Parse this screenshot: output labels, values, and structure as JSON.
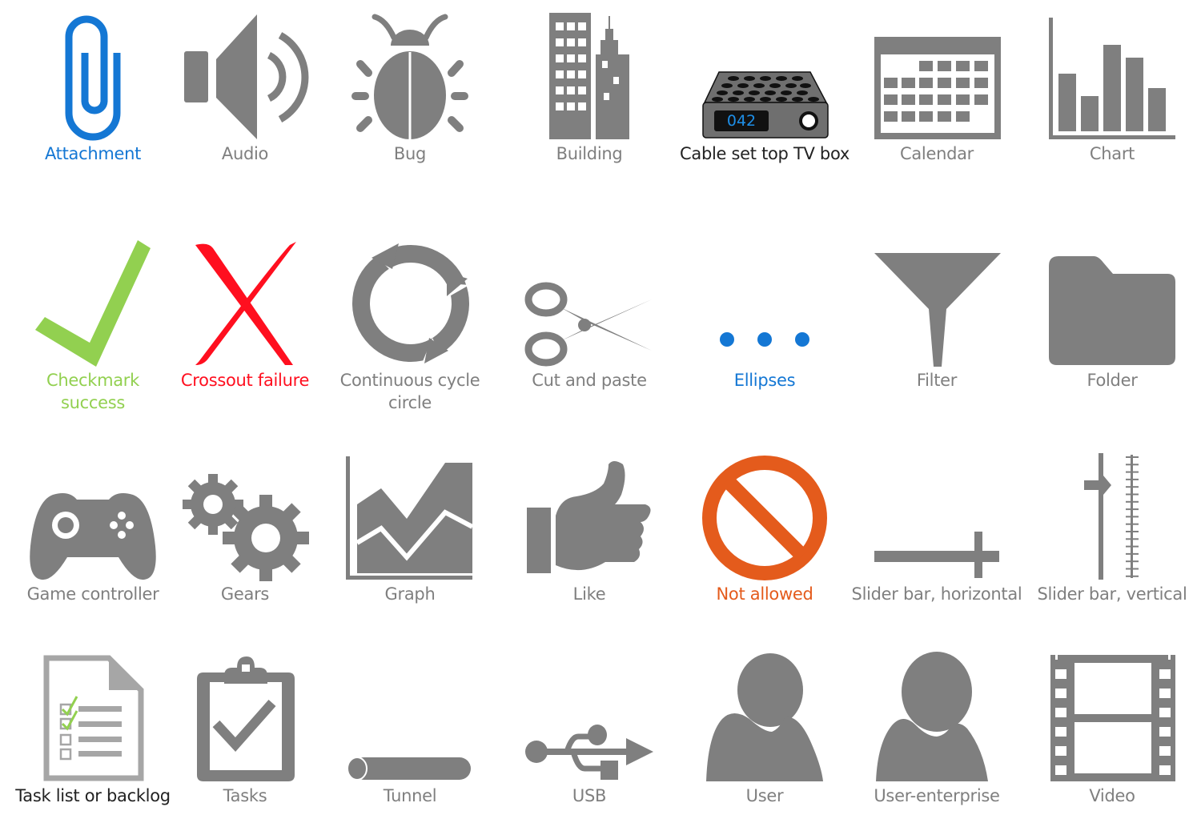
{
  "colors": {
    "gray": "#7f7f7f",
    "blue": "#1477d4",
    "green": "#92d050",
    "red": "#ff0f1f",
    "orange": "#e45b1c",
    "dark": "#222222",
    "light_gray": "#a6a6a6"
  },
  "icons": [
    {
      "id": "attachment",
      "label": "Attachment",
      "icon": "paperclip-icon",
      "color": "#1477d4"
    },
    {
      "id": "audio",
      "label": "Audio",
      "icon": "speaker-icon",
      "color": "#7f7f7f"
    },
    {
      "id": "bug",
      "label": "Bug",
      "icon": "bug-icon",
      "color": "#7f7f7f"
    },
    {
      "id": "building",
      "label": "Building",
      "icon": "building-icon",
      "color": "#7f7f7f"
    },
    {
      "id": "cable-box",
      "label": "Cable set top TV box",
      "icon": "cable-box-icon",
      "color": "#222222",
      "display_value": "042"
    },
    {
      "id": "calendar",
      "label": "Calendar",
      "icon": "calendar-icon",
      "color": "#7f7f7f"
    },
    {
      "id": "chart",
      "label": "Chart",
      "icon": "bar-chart-icon",
      "color": "#7f7f7f"
    },
    {
      "id": "checkmark",
      "label": "Checkmark\nsuccess",
      "label_line1": "Checkmark",
      "label_line2": "success",
      "icon": "checkmark-icon",
      "color": "#92d050"
    },
    {
      "id": "crossout",
      "label": "Crossout failure",
      "icon": "cross-icon",
      "color": "#ff0f1f"
    },
    {
      "id": "cycle",
      "label": "Continuous cycle circle",
      "label_line1": "Continuous cycle",
      "label_line2": "circle",
      "icon": "cycle-icon",
      "color": "#7f7f7f"
    },
    {
      "id": "cut",
      "label": "Cut and paste",
      "icon": "scissors-icon",
      "color": "#7f7f7f"
    },
    {
      "id": "ellipses",
      "label": "Ellipses",
      "icon": "ellipsis-icon",
      "color": "#1477d4"
    },
    {
      "id": "filter",
      "label": "Filter",
      "icon": "funnel-icon",
      "color": "#7f7f7f"
    },
    {
      "id": "folder",
      "label": "Folder",
      "icon": "folder-icon",
      "color": "#7f7f7f"
    },
    {
      "id": "game",
      "label": "Game controller",
      "icon": "gamepad-icon",
      "color": "#7f7f7f"
    },
    {
      "id": "gears",
      "label": "Gears",
      "icon": "gears-icon",
      "color": "#7f7f7f"
    },
    {
      "id": "graph",
      "label": "Graph",
      "icon": "area-graph-icon",
      "color": "#7f7f7f"
    },
    {
      "id": "like",
      "label": "Like",
      "icon": "thumbs-up-icon",
      "color": "#7f7f7f"
    },
    {
      "id": "not-allowed",
      "label": "Not allowed",
      "icon": "prohibited-icon",
      "color": "#e45b1c"
    },
    {
      "id": "slider-h",
      "label": "Slider bar, horizontal",
      "icon": "slider-horizontal-icon",
      "color": "#7f7f7f"
    },
    {
      "id": "slider-v",
      "label": "Slider bar, vertical",
      "icon": "slider-vertical-icon",
      "color": "#7f7f7f"
    },
    {
      "id": "task-list",
      "label": "Task list or backlog",
      "icon": "task-list-icon",
      "color": "#222222"
    },
    {
      "id": "tasks",
      "label": "Tasks",
      "icon": "clipboard-check-icon",
      "color": "#7f7f7f"
    },
    {
      "id": "tunnel",
      "label": "Tunnel",
      "icon": "tunnel-icon",
      "color": "#7f7f7f"
    },
    {
      "id": "usb",
      "label": "USB",
      "icon": "usb-icon",
      "color": "#7f7f7f"
    },
    {
      "id": "user",
      "label": "User",
      "icon": "user-icon",
      "color": "#7f7f7f"
    },
    {
      "id": "user-enterprise",
      "label": "User-enterprise",
      "icon": "user-enterprise-icon",
      "color": "#7f7f7f"
    },
    {
      "id": "video",
      "label": "Video",
      "icon": "film-strip-icon",
      "color": "#7f7f7f"
    }
  ]
}
